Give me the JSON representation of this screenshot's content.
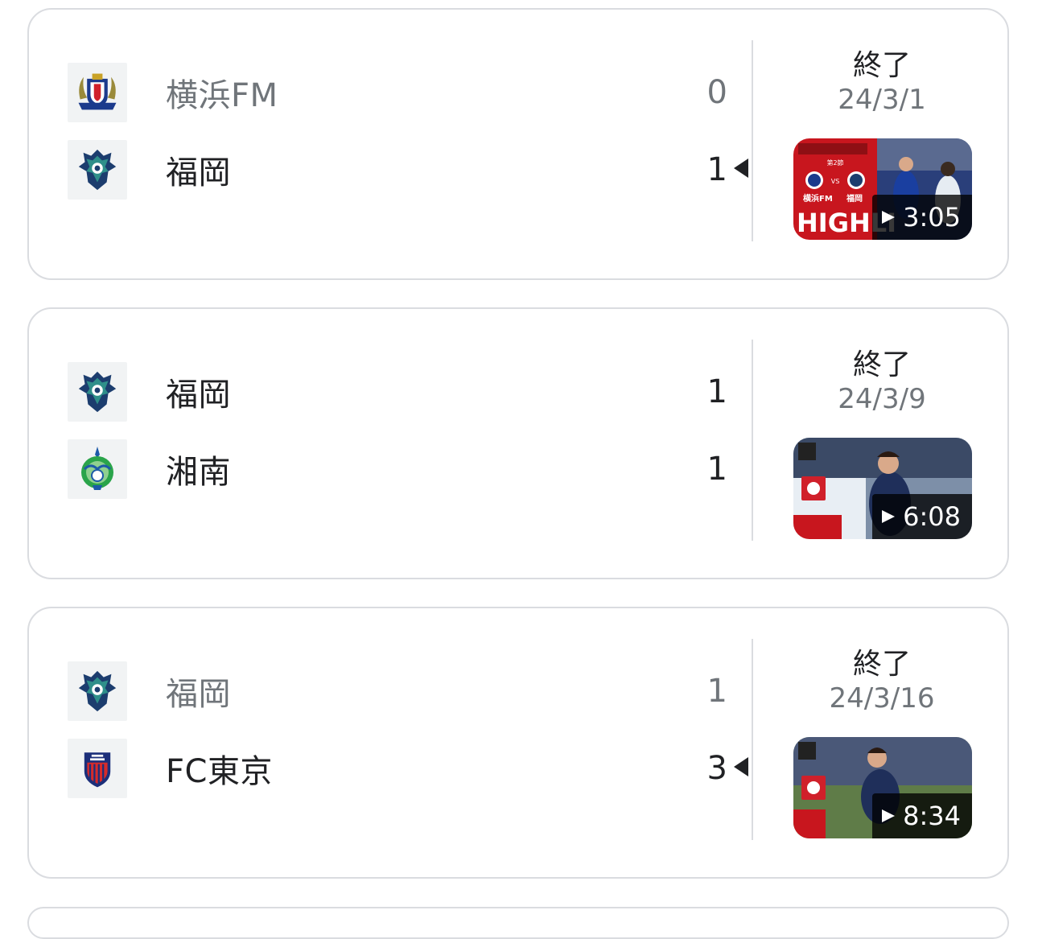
{
  "matches": [
    {
      "home": {
        "name": "横浜FM",
        "score": "0",
        "logo": "yokohama-fm-crest-icon"
      },
      "away": {
        "name": "福岡",
        "score": "1",
        "logo": "avispa-fukuoka-crest-icon"
      },
      "winner": "away",
      "status": "終了",
      "date": "24/3/1",
      "video": {
        "duration": "3:05",
        "thumb_texts": [
          "HIGHLI",
          "横浜FM",
          "福岡",
          "VS",
          "第2節"
        ]
      }
    },
    {
      "home": {
        "name": "福岡",
        "score": "1",
        "logo": "avispa-fukuoka-crest-icon"
      },
      "away": {
        "name": "湘南",
        "score": "1",
        "logo": "shonan-bellmare-crest-icon"
      },
      "winner": "none",
      "status": "終了",
      "date": "24/3/9",
      "video": {
        "duration": "6:08"
      }
    },
    {
      "home": {
        "name": "福岡",
        "score": "1",
        "logo": "avispa-fukuoka-crest-icon"
      },
      "away": {
        "name": "FC東京",
        "score": "3",
        "logo": "fc-tokyo-crest-icon"
      },
      "winner": "away",
      "status": "終了",
      "date": "24/3/16",
      "video": {
        "duration": "8:34"
      }
    }
  ],
  "colors": {
    "border": "#dadce0",
    "text_primary": "#202124",
    "text_secondary": "#70757a"
  }
}
